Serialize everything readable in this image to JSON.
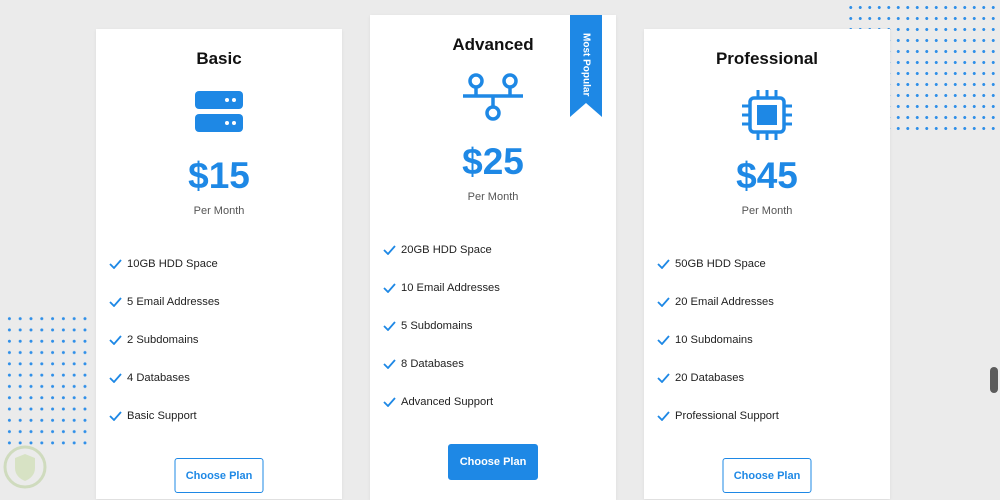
{
  "colors": {
    "accent": "#1e88e5",
    "background": "#ebebeb",
    "card": "#ffffff"
  },
  "plans": [
    {
      "name": "Basic",
      "icon": "server-icon",
      "price": "$15",
      "period": "Per Month",
      "features": [
        "10GB HDD Space",
        "5 Email Addresses",
        "2 Subdomains",
        "4 Databases",
        "Basic Support"
      ],
      "button": "Choose Plan"
    },
    {
      "name": "Advanced",
      "icon": "network-icon",
      "badge": "Most Popular",
      "price": "$25",
      "period": "Per Month",
      "features": [
        "20GB HDD Space",
        "10 Email Addresses",
        "5 Subdomains",
        "8 Databases",
        "Advanced Support"
      ],
      "button": "Choose Plan"
    },
    {
      "name": "Professional",
      "icon": "cpu-chip-icon",
      "price": "$45",
      "period": "Per Month",
      "features": [
        "50GB HDD Space",
        "20 Email Addresses",
        "10 Subdomains",
        "20 Databases",
        "Professional Support"
      ],
      "button": "Choose Plan"
    }
  ]
}
